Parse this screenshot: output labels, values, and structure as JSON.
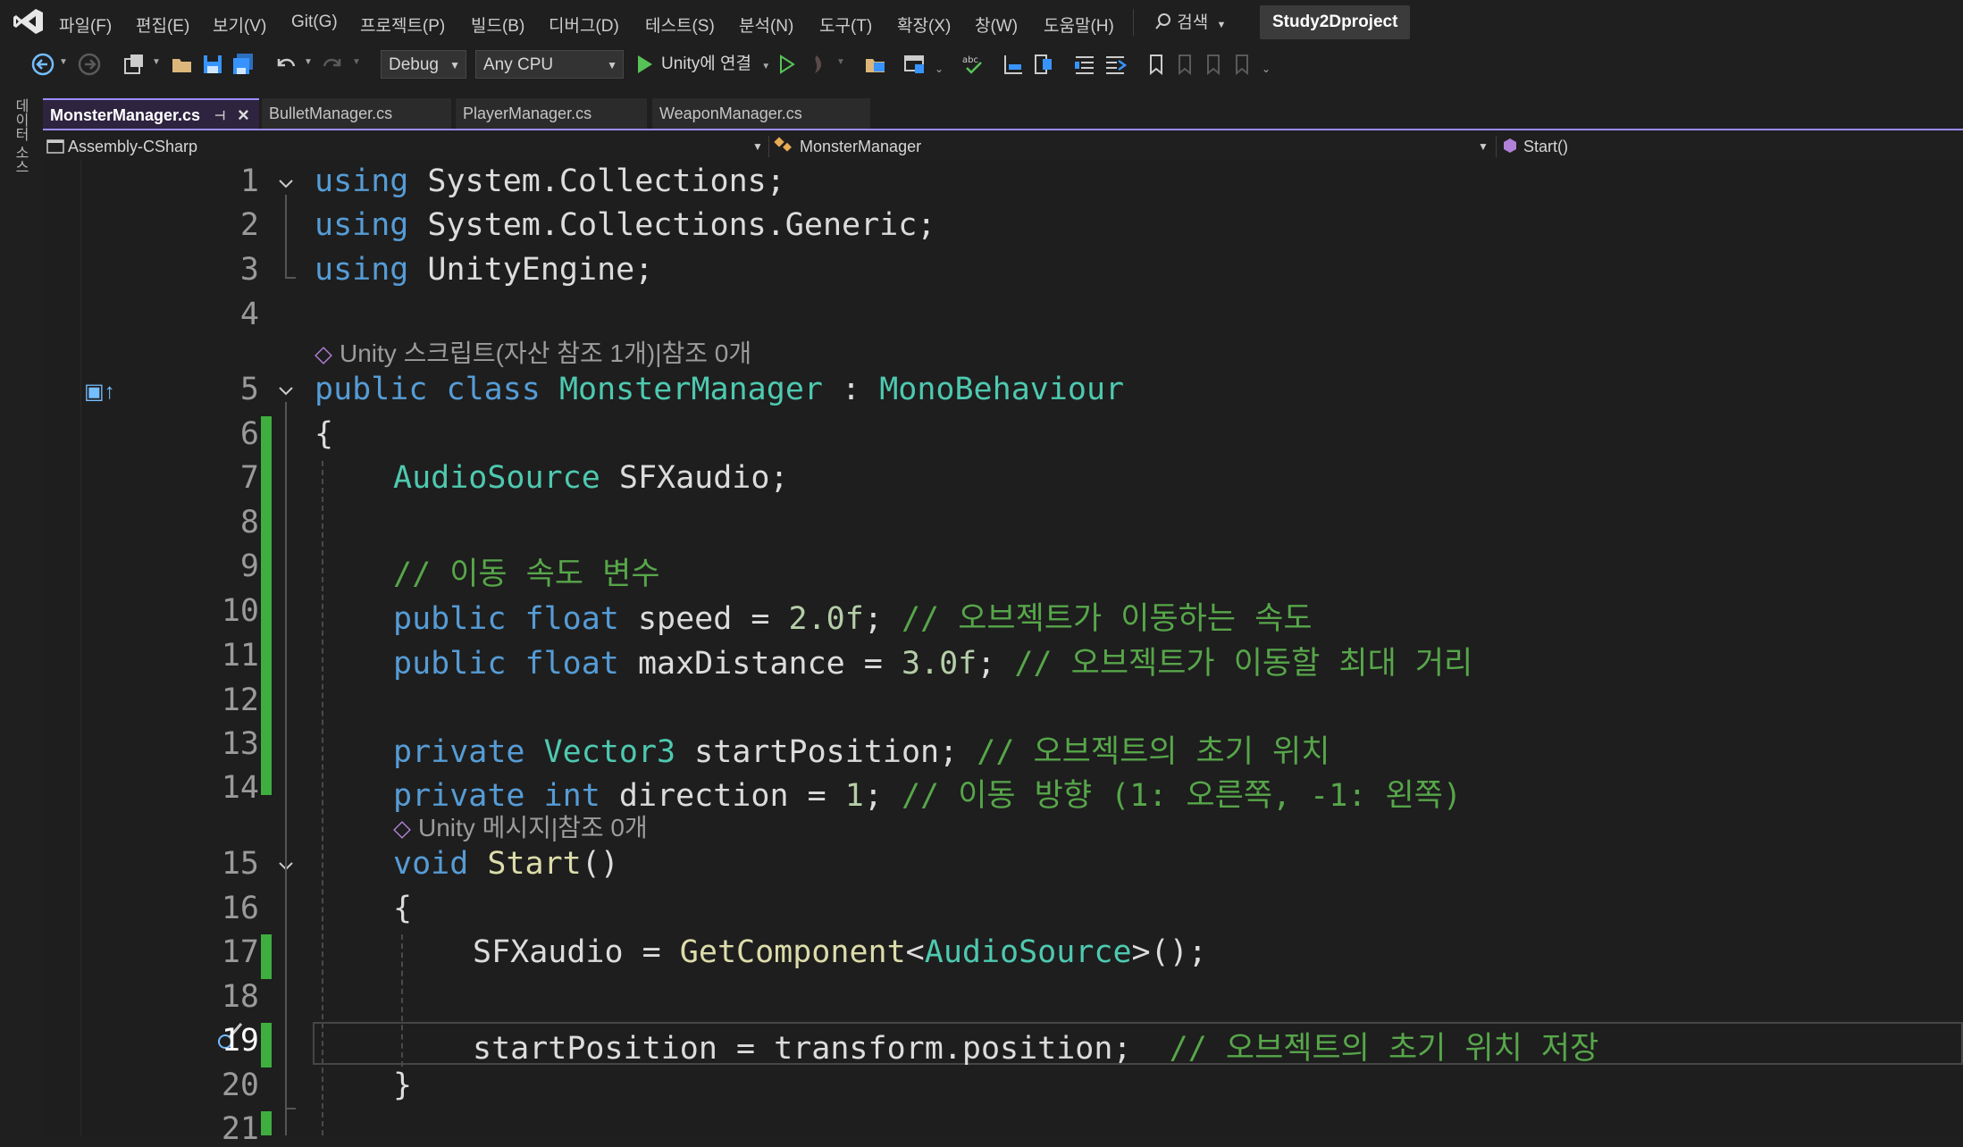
{
  "menu": [
    "파일(F)",
    "편집(E)",
    "보기(V)",
    "Git(G)",
    "프로젝트(P)",
    "빌드(B)",
    "디버그(D)",
    "테스트(S)",
    "분석(N)",
    "도구(T)",
    "확장(X)",
    "창(W)",
    "도움말(H)"
  ],
  "search_label": "검색",
  "project_name": "Study2Dproject",
  "toolbar": {
    "config": "Debug",
    "platform": "Any CPU",
    "run_label": "Unity에 연결"
  },
  "side_panel_label": "데이터 소스",
  "tabs": [
    {
      "label": "MonsterManager.cs"
    },
    {
      "label": "BulletManager.cs"
    },
    {
      "label": "PlayerManager.cs"
    },
    {
      "label": "WeaponManager.cs"
    }
  ],
  "nav": {
    "project": "Assembly-CSharp",
    "type": "MonsterManager",
    "member": "Start()"
  },
  "line_numbers": [
    "1",
    "2",
    "3",
    "4",
    "5",
    "6",
    "7",
    "8",
    "9",
    "10",
    "11",
    "12",
    "13",
    "14",
    "15",
    "16",
    "17",
    "18",
    "19",
    "20",
    "21"
  ],
  "codelens": {
    "class": "Unity 스크립트(자산 참조 1개)|참조 0개",
    "method": "Unity 메시지|참조 0개"
  },
  "code": {
    "l1_kw": "using",
    "l1_rest": " System.Collections;",
    "l2_kw": "using",
    "l2_rest": " System.Collections.Generic;",
    "l3_kw": "using",
    "l3_rest": " UnityEngine;",
    "l5_kw1": "public",
    "l5_kw2": "class",
    "l5_name": "MonsterManager",
    "l5_colon": " : ",
    "l5_base": "MonoBehaviour",
    "l6": "{",
    "l7_type": "AudioSource",
    "l7_rest": " SFXaudio;",
    "l9_cm": "// 이동 속도 변수",
    "l10_kw1": "public",
    "l10_kw2": "float",
    "l10_mid": " speed = ",
    "l10_num": "2.0f",
    "l10_end": "; ",
    "l10_cm": "// 오브젝트가 이동하는 속도",
    "l11_kw1": "public",
    "l11_kw2": "float",
    "l11_mid": " maxDistance = ",
    "l11_num": "3.0f",
    "l11_end": "; ",
    "l11_cm": "// 오브젝트가 이동할 최대 거리",
    "l13_kw": "private",
    "l13_type": "Vector3",
    "l13_mid": " startPosition; ",
    "l13_cm": "// 오브젝트의 초기 위치",
    "l14_kw1": "private",
    "l14_kw2": "int",
    "l14_mid": " direction = ",
    "l14_num": "1",
    "l14_end": "; ",
    "l14_cm": "// 이동 방향 (1: 오른쪽, -1: 왼쪽)",
    "l15_kw": "void",
    "l15_fn": "Start",
    "l15_end": "()",
    "l16": "{",
    "l17_a": "SFXaudio = ",
    "l17_fn": "GetComponent",
    "l17_lt": "<",
    "l17_type": "AudioSource",
    "l17_end": ">();",
    "l19_a": "startPosition = transform.position;  ",
    "l19_cm": "// 오브젝트의 초기 위치 저장",
    "l20": "}"
  },
  "colors": {
    "keyword": "#569cd6",
    "type": "#4ec9b0",
    "comment": "#57a64a",
    "number": "#b5cea8",
    "method": "#dcdcaa",
    "change_bar": "#3fae3f",
    "active_tab_border": "#9d8cff"
  }
}
